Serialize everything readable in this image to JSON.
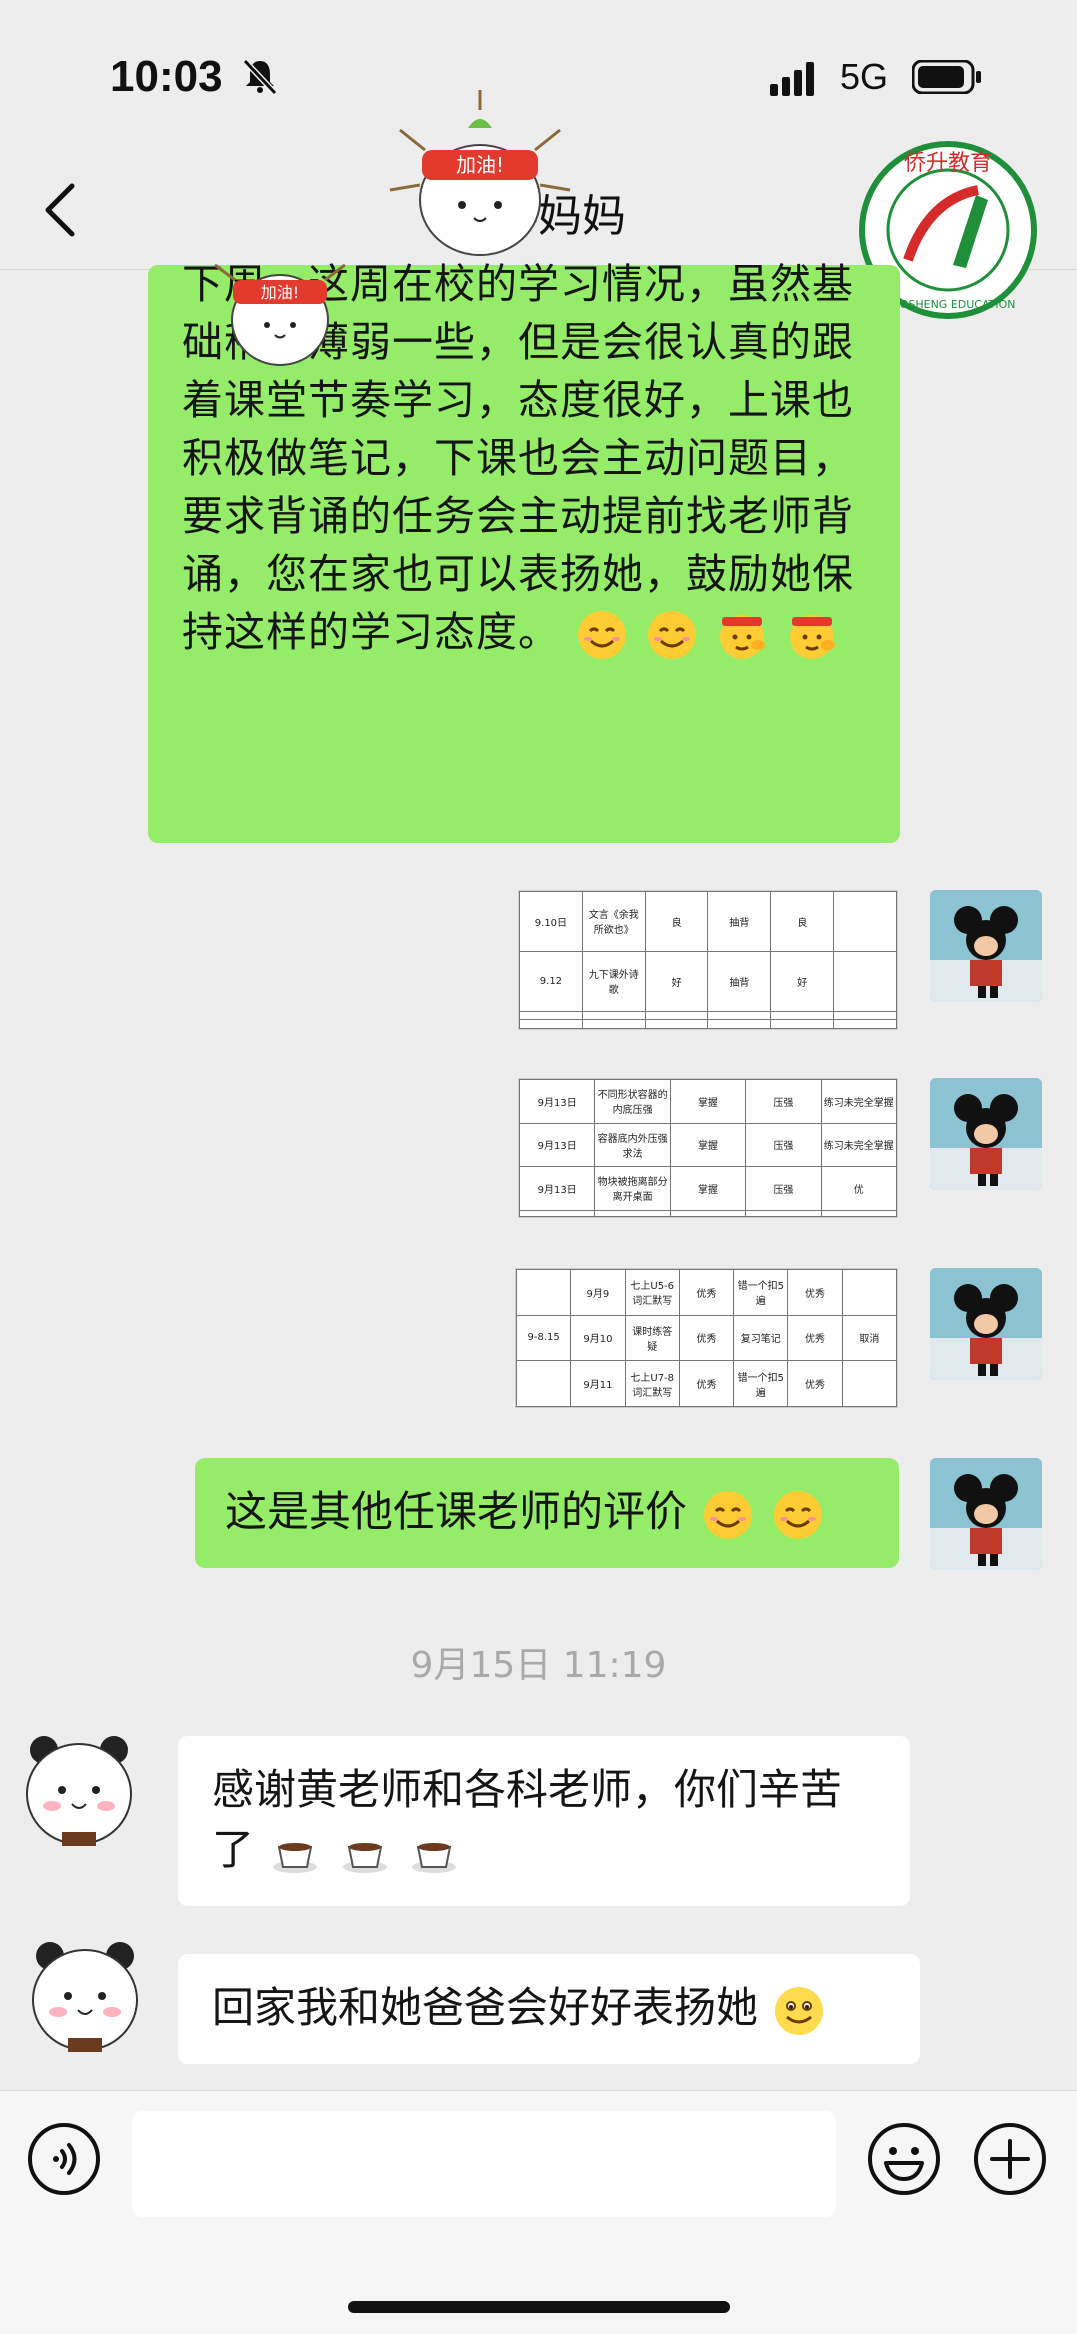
{
  "status_bar": {
    "time": "10:03",
    "network": "5G"
  },
  "nav": {
    "title": "…伴妈妈",
    "logo_text_cn": "侨升教育",
    "logo_text_en": "QIAOSHENG EDUCATION"
  },
  "stickers": {
    "headband_text": "加油!"
  },
  "messages": {
    "teacher_long": "下周一这周在校的学习情况，虽然基础稍微薄弱一些，但是会很认真的跟着课堂节奏学习，态度很好，上课也积极做笔记，下课也会主动问题目，要求背诵的任务会主动提前找老师背诵，您在家也可以表扬她，鼓励她保持这样的学习态度。",
    "table1": [
      [
        "9.10日",
        "文言《余我所欲也》",
        "良",
        "抽背",
        "良",
        ""
      ],
      [
        "9.12",
        "九下课外诗歌",
        "好",
        "抽背",
        "好",
        ""
      ],
      [
        "",
        "",
        "",
        "",
        "",
        ""
      ],
      [
        "",
        "",
        "",
        "",
        "",
        ""
      ]
    ],
    "table2": [
      [
        "9月13日",
        "不同形状容器的内底压强",
        "掌握",
        "压强",
        "练习未完全掌握"
      ],
      [
        "9月13日",
        "容器底内外压强求法",
        "掌握",
        "压强",
        "练习未完全掌握"
      ],
      [
        "9月13日",
        "物块被拖离部分离开桌面",
        "掌握",
        "压强",
        "优"
      ],
      [
        "",
        "",
        "",
        "",
        ""
      ]
    ],
    "table3": [
      [
        "",
        "9月9",
        "七上U5-6词汇默写",
        "优秀",
        "错一个扣5遍",
        "优秀",
        ""
      ],
      [
        "9-8.15",
        "9月10",
        "课时练答疑",
        "优秀",
        "复习笔记",
        "优秀",
        "取消"
      ],
      [
        "",
        "9月11",
        "七上U7-8词汇默写",
        "优秀",
        "错一个扣5遍",
        "优秀",
        ""
      ]
    ],
    "other_teachers": "这是其他任课老师的评价",
    "timestamp": "9月15日 11:19",
    "parent_thanks": "感谢黄老师和各科老师，你们辛苦了",
    "parent_praise": "回家我和她爸爸会好好表扬她"
  },
  "icons": {
    "smile": "smile-emoji",
    "salute": "salute-emoji",
    "coffee": "coffee-emoji",
    "grin": "grin-emoji"
  },
  "colors": {
    "green_bubble": "#95ec69",
    "background": "#ededed",
    "white_bubble": "#ffffff"
  }
}
